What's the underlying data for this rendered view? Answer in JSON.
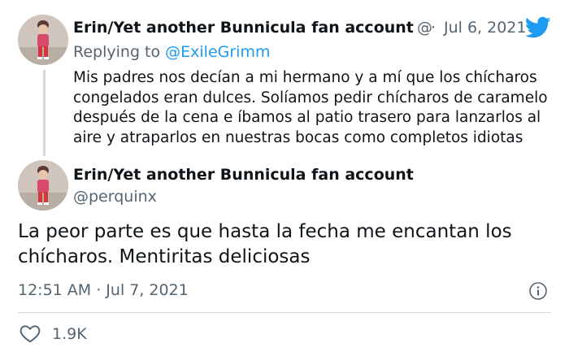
{
  "first_tweet": {
    "author_name": "Erin/Yet another Bunnicula fan account",
    "handle_truncated": "@",
    "separator": "·",
    "date": "Jul 6, 2021",
    "replying_to_label": "Replying to ",
    "replying_to_handle": "@ExileGrimm",
    "text": "Mis padres nos decían a mi hermano y a mí que los chícharos congelados eran dulces. Solíamos pedir chícharos de caramelo después de la cena e íbamos al patio trasero para lanzarlos al aire y atraparlos en nuestras bocas como completos idiotas"
  },
  "main_tweet": {
    "author_name": "Erin/Yet another Bunnicula fan account",
    "handle": "@perquinx",
    "text": "La peor parte es que hasta la fecha me encantan los chícharos. Mentiritas deliciosas",
    "timestamp": "12:51 AM · Jul 7, 2021",
    "like_count": "1.9K"
  },
  "icons": {
    "brand": "twitter-bird-icon",
    "info": "info-icon",
    "like": "heart-icon",
    "brand_color": "#1d9bf0"
  }
}
